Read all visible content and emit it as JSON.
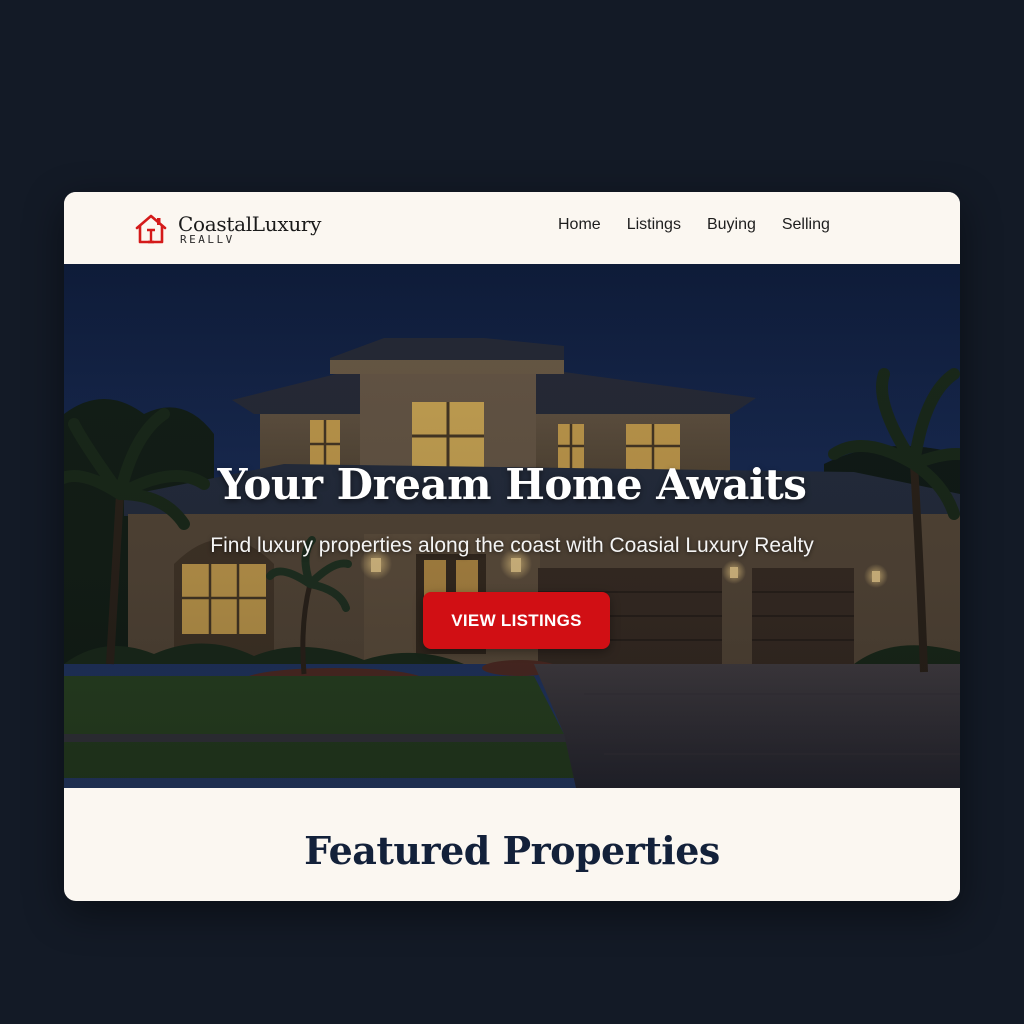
{
  "brand": {
    "name": "CoastalLuxury",
    "sub": "REALLV",
    "icon": "house-logo-icon"
  },
  "nav": {
    "items": [
      {
        "label": "Home"
      },
      {
        "label": "Listings"
      },
      {
        "label": "Buying"
      },
      {
        "label": "Selling"
      }
    ]
  },
  "hero": {
    "title": "Your Dream Home Awaits",
    "subtitle": "Find luxury properties along the coast with Coasial Luxury Realty",
    "cta_label": "VIEW LISTINGS",
    "image": "luxury-house-at-dusk"
  },
  "featured": {
    "title": "Featured Properties"
  },
  "colors": {
    "accent": "#d10f14",
    "page_bg": "#131a26",
    "card_bg": "#fbf7f1",
    "heading": "#13213a"
  }
}
